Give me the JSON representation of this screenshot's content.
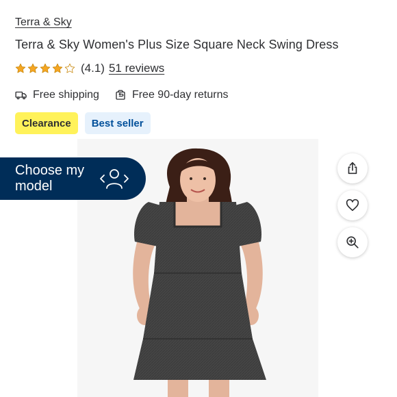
{
  "product": {
    "brand": "Terra & Sky",
    "title": "Terra & Sky Women's Plus Size Square Neck Swing Dress",
    "rating": 4.1,
    "rating_text": "(4.1)",
    "reviews_text": "51 reviews",
    "star_color": "#f5a623"
  },
  "fulfillment": {
    "shipping": {
      "label": "Free shipping",
      "icon": "truck-icon"
    },
    "returns": {
      "label": "Free 90-day returns",
      "icon": "returns-icon"
    }
  },
  "badges": [
    {
      "label": "Clearance",
      "color": "#fff25a"
    },
    {
      "label": "Best seller",
      "color": "#e6f1fc"
    }
  ],
  "choose_model": {
    "label": "Choose my model",
    "icon": "person-arrows-icon",
    "color": "#002d58"
  },
  "image_actions": [
    {
      "name": "share",
      "icon": "share-icon"
    },
    {
      "name": "favorite",
      "icon": "heart-icon"
    },
    {
      "name": "zoom",
      "icon": "zoom-in-icon"
    }
  ]
}
